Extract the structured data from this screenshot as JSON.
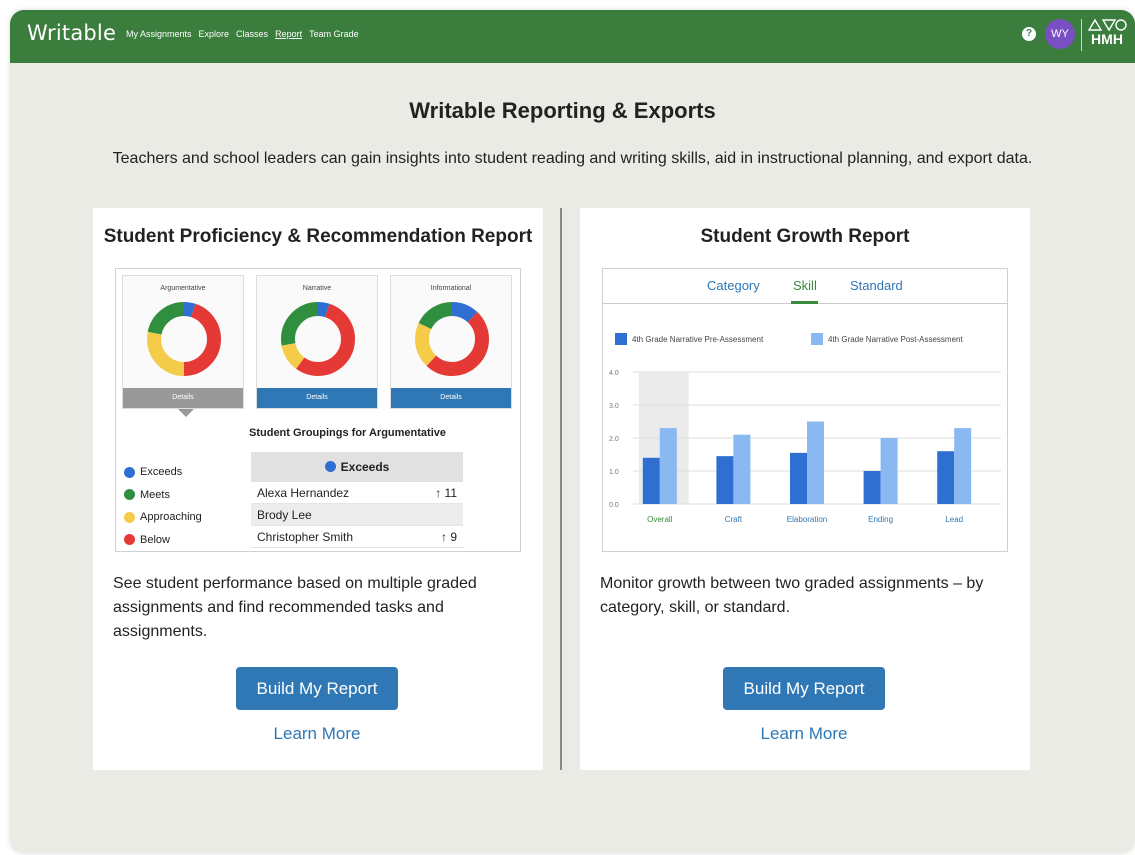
{
  "app": {
    "logo": "Writable",
    "nav": [
      "My Assignments",
      "Explore",
      "Classes",
      "Report",
      "Team Grade"
    ],
    "active_nav": "Report",
    "help_icon": "?",
    "avatar_initials": "WY",
    "brand": "HMH",
    "colors": {
      "header": "#3a7d3c",
      "accent": "#2f77b5",
      "avatar": "#7b4fc4"
    }
  },
  "page": {
    "title": "Writable Reporting & Exports",
    "subtitle": "Teachers and school leaders can gain insights into student reading and writing skills, aid in instructional planning, and export data."
  },
  "proficiency_card": {
    "title": "Student Proficiency & Recommendation Report",
    "donuts": [
      {
        "label": "Argumentative",
        "details": "Details",
        "selected": true,
        "segments": [
          {
            "color": "#2f6fd1",
            "value": 5
          },
          {
            "color": "#e53935",
            "value": 45
          },
          {
            "color": "#f4cc4a",
            "value": 28
          },
          {
            "color": "#2f8f3f",
            "value": 22
          }
        ]
      },
      {
        "label": "Narrative",
        "details": "Details",
        "selected": false,
        "segments": [
          {
            "color": "#2f6fd1",
            "value": 5
          },
          {
            "color": "#e53935",
            "value": 55
          },
          {
            "color": "#f4cc4a",
            "value": 12
          },
          {
            "color": "#2f8f3f",
            "value": 28
          }
        ]
      },
      {
        "label": "Informational",
        "details": "Details",
        "selected": false,
        "segments": [
          {
            "color": "#2f6fd1",
            "value": 12
          },
          {
            "color": "#e53935",
            "value": 50
          },
          {
            "color": "#f4cc4a",
            "value": 20
          },
          {
            "color": "#2f8f3f",
            "value": 18
          }
        ]
      }
    ],
    "groupings_title": "Student Groupings for Argumentative",
    "legend": [
      {
        "label": "Exceeds",
        "color": "#2f6fd1"
      },
      {
        "label": "Meets",
        "color": "#2f8f3f"
      },
      {
        "label": "Approaching",
        "color": "#f4cc4a"
      },
      {
        "label": "Below",
        "color": "#e53935"
      }
    ],
    "table_header": "Exceeds",
    "students": [
      {
        "name": "Alexa Hernandez",
        "change": "↑ 11"
      },
      {
        "name": "Brody Lee",
        "change": ""
      },
      {
        "name": "Christopher Smith",
        "change": "↑ 9"
      }
    ],
    "description": "See student performance based on multiple graded assignments and find recommended tasks and assignments.",
    "button": "Build My Report",
    "learn_more": "Learn More"
  },
  "growth_card": {
    "title": "Student Growth Report",
    "tabs": [
      "Category",
      "Skill",
      "Standard"
    ],
    "active_tab": "Skill",
    "description": "Monitor growth between two graded assignments – by category, skill, or standard.",
    "button": "Build My Report",
    "learn_more": "Learn More"
  },
  "chart_data": {
    "type": "bar",
    "categories": [
      "Overall",
      "Craft",
      "Elaboration",
      "Ending",
      "Lead"
    ],
    "series": [
      {
        "name": "4th Grade Narrative Pre-Assessment",
        "color": "#2f6fd1",
        "values": [
          1.4,
          1.45,
          1.55,
          1.0,
          1.6
        ]
      },
      {
        "name": "4th Grade Narrative Post-Assessment",
        "color": "#8ab8f0",
        "values": [
          2.3,
          2.1,
          2.5,
          2.0,
          2.3
        ]
      }
    ],
    "yticks": [
      "0.0",
      "1.0",
      "2.0",
      "3.0",
      "4.0"
    ],
    "ylim": [
      0,
      4
    ],
    "highlighted_category": "Overall"
  }
}
